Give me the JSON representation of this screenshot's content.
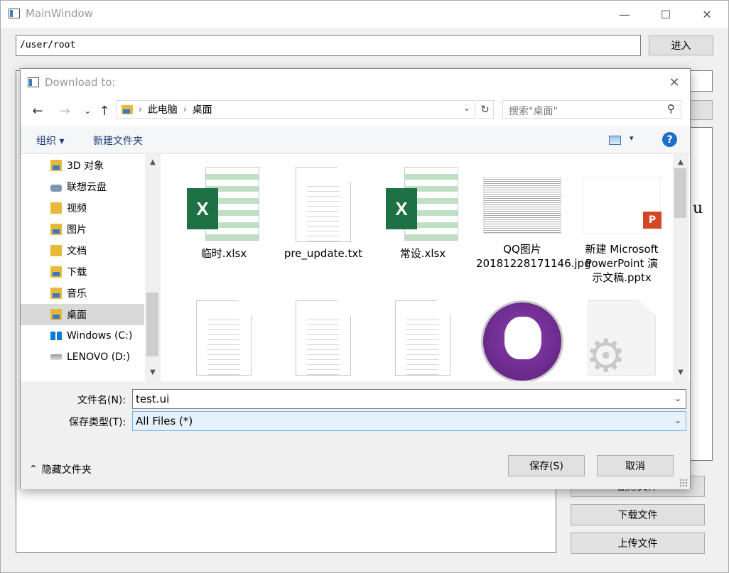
{
  "main": {
    "title": "MainWindow",
    "path_value": "/user/root",
    "enter_label": "进入",
    "right_panel_letter": "u",
    "buttons": {
      "delete_label": "删除文件",
      "download_label": "下载文件",
      "upload_label": "上传文件"
    },
    "window_controls": {
      "minimize": "—",
      "maximize": "☐",
      "close": "✕"
    }
  },
  "dialog": {
    "title": "Download to:",
    "breadcrumb": [
      "此电脑",
      "桌面"
    ],
    "search_placeholder": "搜索\"桌面\"",
    "toolbar": {
      "organize": "组织 ▾",
      "new_folder": "新建文件夹"
    },
    "nav_items": [
      {
        "label": "3D 对象",
        "icon": "folder-3d-icon"
      },
      {
        "label": "联想云盘",
        "icon": "cloud-drive-icon"
      },
      {
        "label": "视频",
        "icon": "videos-folder-icon"
      },
      {
        "label": "图片",
        "icon": "pictures-folder-icon"
      },
      {
        "label": "文档",
        "icon": "documents-folder-icon"
      },
      {
        "label": "下载",
        "icon": "downloads-folder-icon"
      },
      {
        "label": "音乐",
        "icon": "music-folder-icon"
      },
      {
        "label": "桌面",
        "icon": "desktop-folder-icon",
        "selected": true
      },
      {
        "label": "Windows (C:)",
        "icon": "windows-drive-icon"
      },
      {
        "label": "LENOVO (D:)",
        "icon": "drive-icon"
      }
    ],
    "files": [
      {
        "name": "临时.xlsx",
        "kind": "xlsx"
      },
      {
        "name": "pre_update.txt",
        "kind": "txt"
      },
      {
        "name": "常设.xlsx",
        "kind": "xlsx"
      },
      {
        "name": "QQ图片\n20181228171146.jpg",
        "kind": "jpg"
      },
      {
        "name": "新建 Microsoft\nPowerPoint 演\n示文稿.pptx",
        "kind": "pptx"
      },
      {
        "name": "",
        "kind": "txt"
      },
      {
        "name": "",
        "kind": "txt"
      },
      {
        "name": "",
        "kind": "txt"
      },
      {
        "name": "",
        "kind": "github"
      },
      {
        "name": "",
        "kind": "config"
      }
    ],
    "filename_label": "文件名(N):",
    "filename_value": "test.ui",
    "filetype_label": "保存类型(T):",
    "filetype_value": "All Files  (*)",
    "hide_folders_label": "隐藏文件夹",
    "save_label": "保存(S)",
    "cancel_label": "取消"
  }
}
